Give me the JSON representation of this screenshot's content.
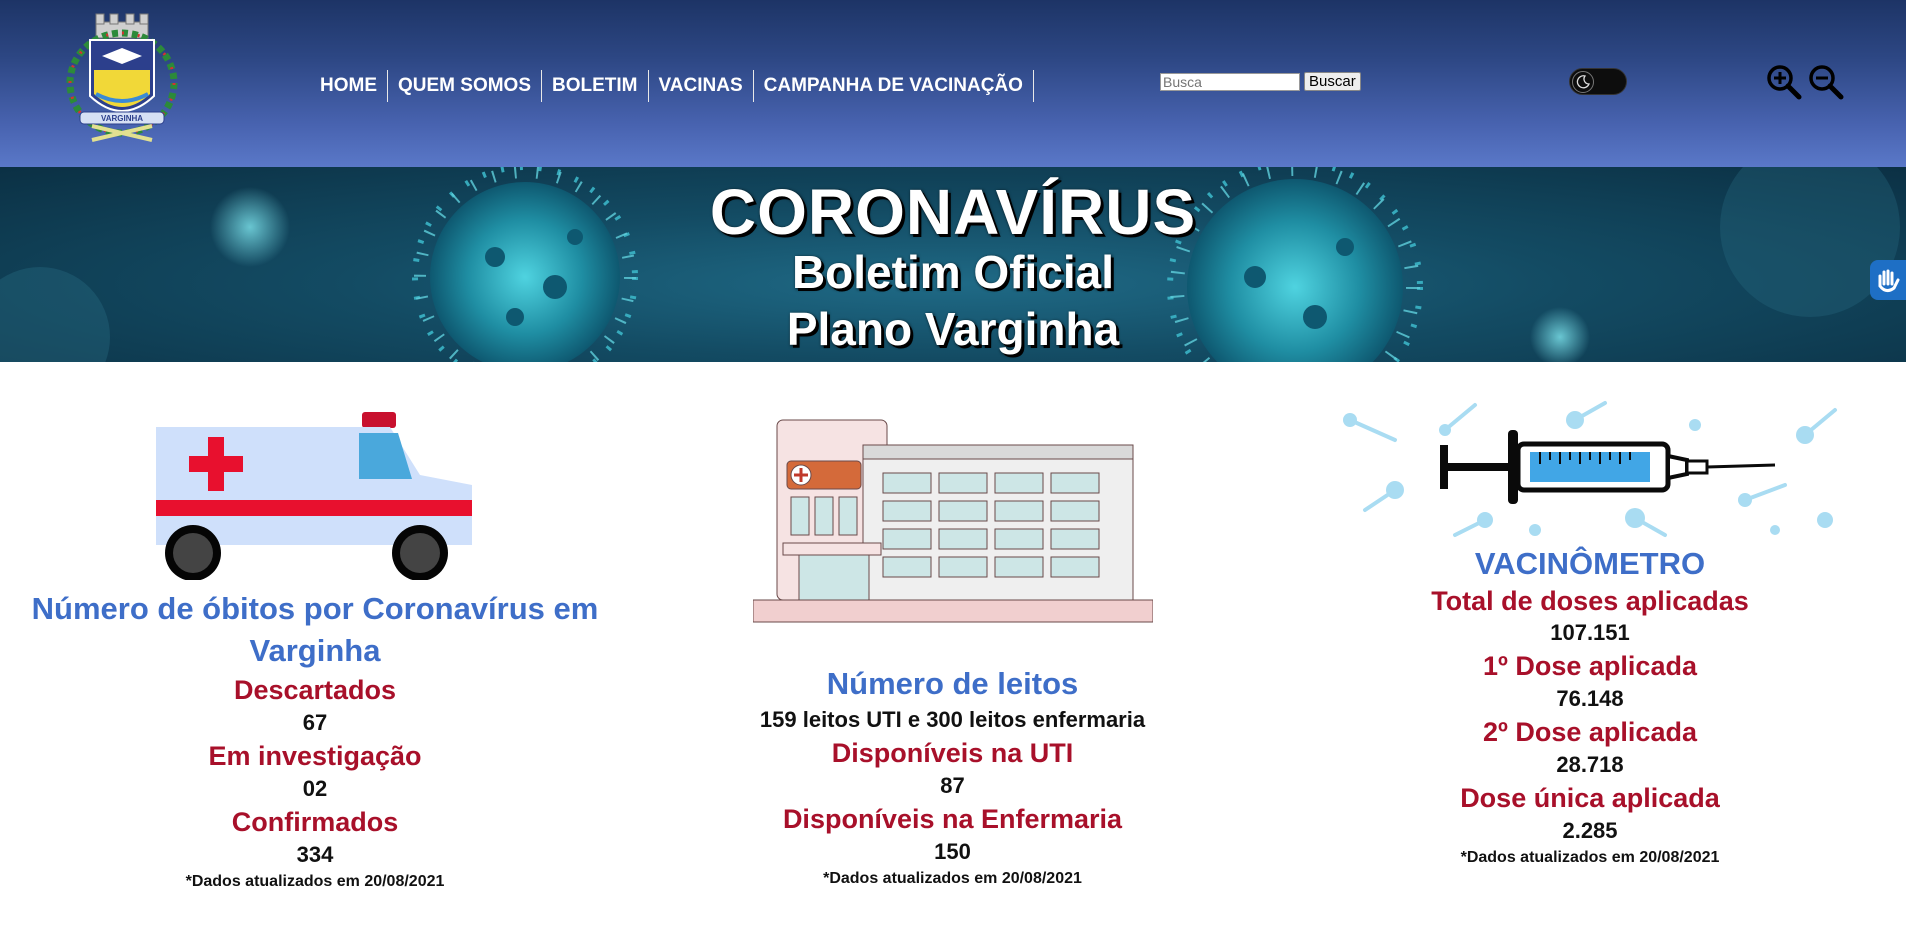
{
  "header": {
    "logo_name": "VARGINHA",
    "nav": [
      "HOME",
      "QUEM SOMOS",
      "BOLETIM",
      "VACINAS",
      "CAMPANHA DE VACINAÇÃO"
    ],
    "search_placeholder": "Busca",
    "search_button": "Buscar"
  },
  "banner": {
    "title": "CORONAVÍRUS",
    "subtitle1": "Boletim Oficial",
    "subtitle2": "Plano Varginha"
  },
  "obitos": {
    "title": "Número de óbitos por Coronavírus em Varginha",
    "discarded_label": "Descartados",
    "discarded_value": "67",
    "investigation_label": "Em investigação",
    "investigation_value": "02",
    "confirmed_label": "Confirmados",
    "confirmed_value": "334",
    "note": "*Dados atualizados em 20/08/2021"
  },
  "leitos": {
    "title": "Número de leitos",
    "summary": "159 leitos UTI e 300 leitos enfermaria",
    "uti_label": "Disponíveis na UTI",
    "uti_value": "87",
    "enf_label": "Disponíveis na Enfermaria",
    "enf_value": "150",
    "note": "*Dados atualizados em 20/08/2021"
  },
  "vacinometro": {
    "title": "VACINÔMETRO",
    "total_label": "Total de doses aplicadas",
    "total_value": "107.151",
    "dose1_label": "1º Dose aplicada",
    "dose1_value": "76.148",
    "dose2_label": "2º Dose aplicada",
    "dose2_value": "28.718",
    "single_label": "Dose única aplicada",
    "single_value": "2.285",
    "note": "*Dados atualizados em 20/08/2021"
  },
  "colors": {
    "header_dark": "#1d3466",
    "header_light": "#5a78c8",
    "title_blue": "#3e6ec8",
    "label_red": "#a8102a"
  }
}
